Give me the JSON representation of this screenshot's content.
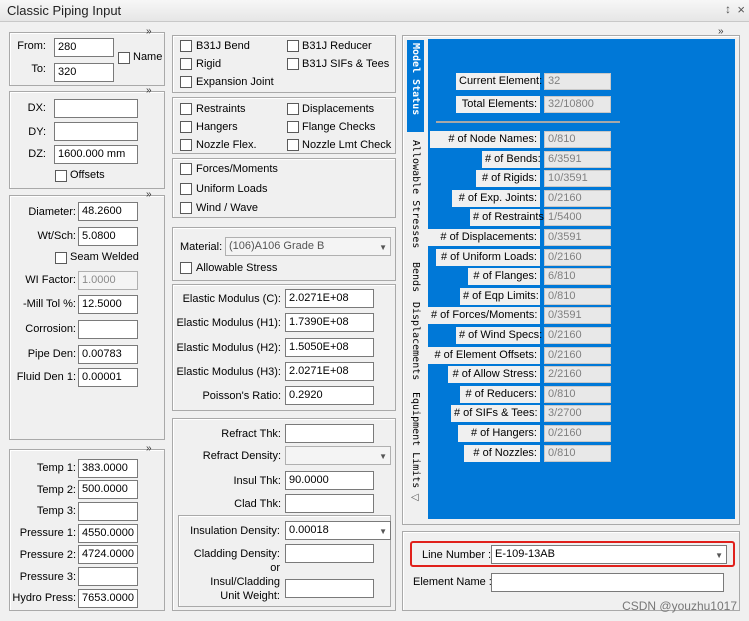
{
  "window": {
    "title": "Classic Piping Input",
    "pin_glyph": "↕",
    "close_glyph": "×"
  },
  "chevron": "»",
  "nodes": {
    "from_label": "From:",
    "from_value": "280",
    "to_label": "To:",
    "to_value": "320",
    "name_label": "Name"
  },
  "deltas": {
    "dx_label": "DX:",
    "dx_value": "",
    "dy_label": "DY:",
    "dy_value": "",
    "dz_label": "DZ:",
    "dz_value": "1600.000 mm",
    "offsets_label": "Offsets"
  },
  "pipe": {
    "diameter_label": "Diameter:",
    "diameter_value": "48.2600",
    "wtsch_label": "Wt/Sch:",
    "wtsch_value": "5.0800",
    "seam_label": "Seam Welded",
    "wi_label": "WI Factor:",
    "wi_value": "1.0000",
    "mill_label": "-Mill Tol %:",
    "mill_value": "12.5000",
    "corrosion_label": "Corrosion:",
    "corrosion_value": "",
    "pipeden_label": "Pipe Den:",
    "pipeden_value": "0.00783",
    "fluid_label": "Fluid Den 1:",
    "fluid_value": "0.00001"
  },
  "temps": {
    "t1_label": "Temp 1:",
    "t1_value": "383.0000",
    "t2_label": "Temp 2:",
    "t2_value": "500.0000",
    "t3_label": "Temp 3:",
    "t3_value": "",
    "p1_label": "Pressure 1:",
    "p1_value": "4550.0000",
    "p2_label": "Pressure 2:",
    "p2_value": "4724.0000",
    "p3_label": "Pressure 3:",
    "p3_value": "",
    "hydro_label": "Hydro Press:",
    "hydro_value": "7653.0000"
  },
  "checks": {
    "b31j_bend": "B31J Bend",
    "b31j_reducer": "B31J Reducer",
    "rigid": "Rigid",
    "b31j_sifs": "B31J SIFs & Tees",
    "expansion": "Expansion Joint",
    "restraints": "Restraints",
    "displacements": "Displacements",
    "hangers": "Hangers",
    "flange_checks": "Flange Checks",
    "nozzle_flex": "Nozzle Flex.",
    "nozzle_lmt": "Nozzle Lmt Check",
    "forces": "Forces/Moments",
    "uniform": "Uniform Loads",
    "wind": "Wind / Wave"
  },
  "material": {
    "label": "Material:",
    "value": "(106)A106 Grade B",
    "allowable_label": "Allowable Stress"
  },
  "elastic": {
    "c_label": "Elastic Modulus (C):",
    "c_value": "2.0271E+08",
    "h1_label": "Elastic Modulus (H1):",
    "h1_value": "1.7390E+08",
    "h2_label": "Elastic Modulus (H2):",
    "h2_value": "1.5050E+08",
    "h3_label": "Elastic Modulus (H3):",
    "h3_value": "2.0271E+08",
    "poisson_label": "Poisson's Ratio:",
    "poisson_value": "0.2920"
  },
  "insulation": {
    "refract_thk_label": "Refract Thk:",
    "refract_thk_value": "",
    "refract_den_label": "Refract Density:",
    "refract_den_value": "",
    "insul_thk_label": "Insul Thk:",
    "insul_thk_value": "90.0000",
    "clad_thk_label": "Clad Thk:",
    "clad_thk_value": "",
    "insul_den_label": "Insulation Density:",
    "insul_den_value": "0.00018",
    "clad_den_label": "Cladding Density:",
    "clad_den_value": "",
    "or_label": "or",
    "insul_clad_label1": "Insul/Cladding",
    "insul_clad_label2": "Unit Weight:",
    "insul_clad_value": ""
  },
  "tabs": {
    "model_status": "Model Status",
    "allowable": "Allowable Stresses",
    "bends": "Bends",
    "displacements": "Displacements",
    "equipment": "Equipment Limits",
    "scroll_glyph": "◁"
  },
  "status": {
    "current_label": "Current Element:",
    "current_value": "32",
    "total_label": "Total Elements:",
    "total_value": "32/10800",
    "rows": [
      {
        "label": "# of Node Names:",
        "value": "0/810"
      },
      {
        "label": "# of Bends:",
        "value": "6/3591"
      },
      {
        "label": "# of Rigids:",
        "value": "10/3591"
      },
      {
        "label": "# of Exp. Joints:",
        "value": "0/2160"
      },
      {
        "label": "# of Restraints:",
        "value": "1/5400"
      },
      {
        "label": "# of Displacements:",
        "value": "0/3591"
      },
      {
        "label": "# of Uniform Loads:",
        "value": "0/2160"
      },
      {
        "label": "# of Flanges:",
        "value": "6/810"
      },
      {
        "label": "# of Eqp Limits:",
        "value": "0/810"
      },
      {
        "label": "# of Forces/Moments:",
        "value": "0/3591"
      },
      {
        "label": "# of Wind Specs:",
        "value": "0/2160"
      },
      {
        "label": "# of Element Offsets:",
        "value": "0/2160"
      },
      {
        "label": "# of Allow Stress:",
        "value": "2/2160"
      },
      {
        "label": "# of Reducers:",
        "value": "0/810"
      },
      {
        "label": "# of SIFs & Tees:",
        "value": "3/2700"
      },
      {
        "label": "# of Hangers:",
        "value": "0/2160"
      },
      {
        "label": "# of Nozzles:",
        "value": "0/810"
      }
    ]
  },
  "line": {
    "label": "Line Number :",
    "value": "E-109-13AB",
    "element_name_label": "Element Name :",
    "element_name_value": ""
  },
  "watermark": "CSDN @youzhu1017",
  "colors": {
    "status_blue": "#0078d7",
    "highlight_red": "#e0201b"
  }
}
